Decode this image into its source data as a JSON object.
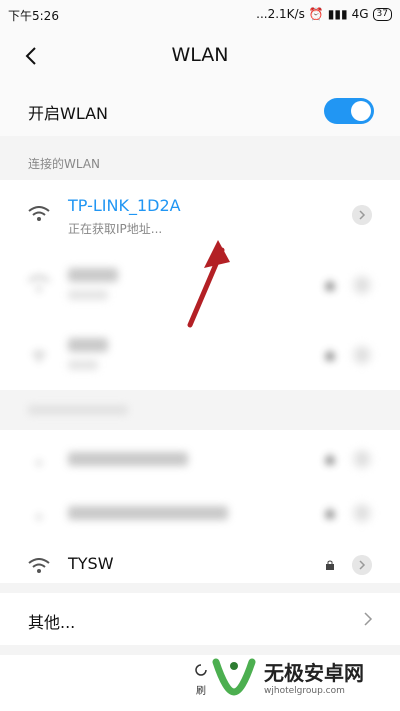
{
  "status": {
    "time": "下午5:26",
    "speed": "...2.1K/s",
    "network": "4G",
    "battery": "37"
  },
  "header": {
    "title": "WLAN"
  },
  "wlan_toggle": {
    "label": "开启WLAN",
    "state": "on"
  },
  "section": {
    "connected_label": "连接的WLAN"
  },
  "connected": {
    "ssid": "TP-LINK_1D2A",
    "status": "正在获取IP地址..."
  },
  "networks": [
    {
      "name": "TYSW",
      "secured": true
    }
  ],
  "other": {
    "label": "其他..."
  },
  "bottom": {
    "refresh_label": "刷"
  },
  "watermark": {
    "title": "无极安卓网",
    "url": "wjhotelgroup.com"
  },
  "colors": {
    "accent": "#2196f3",
    "arrow": "#b32025",
    "watermark_green": "#4caf50"
  }
}
